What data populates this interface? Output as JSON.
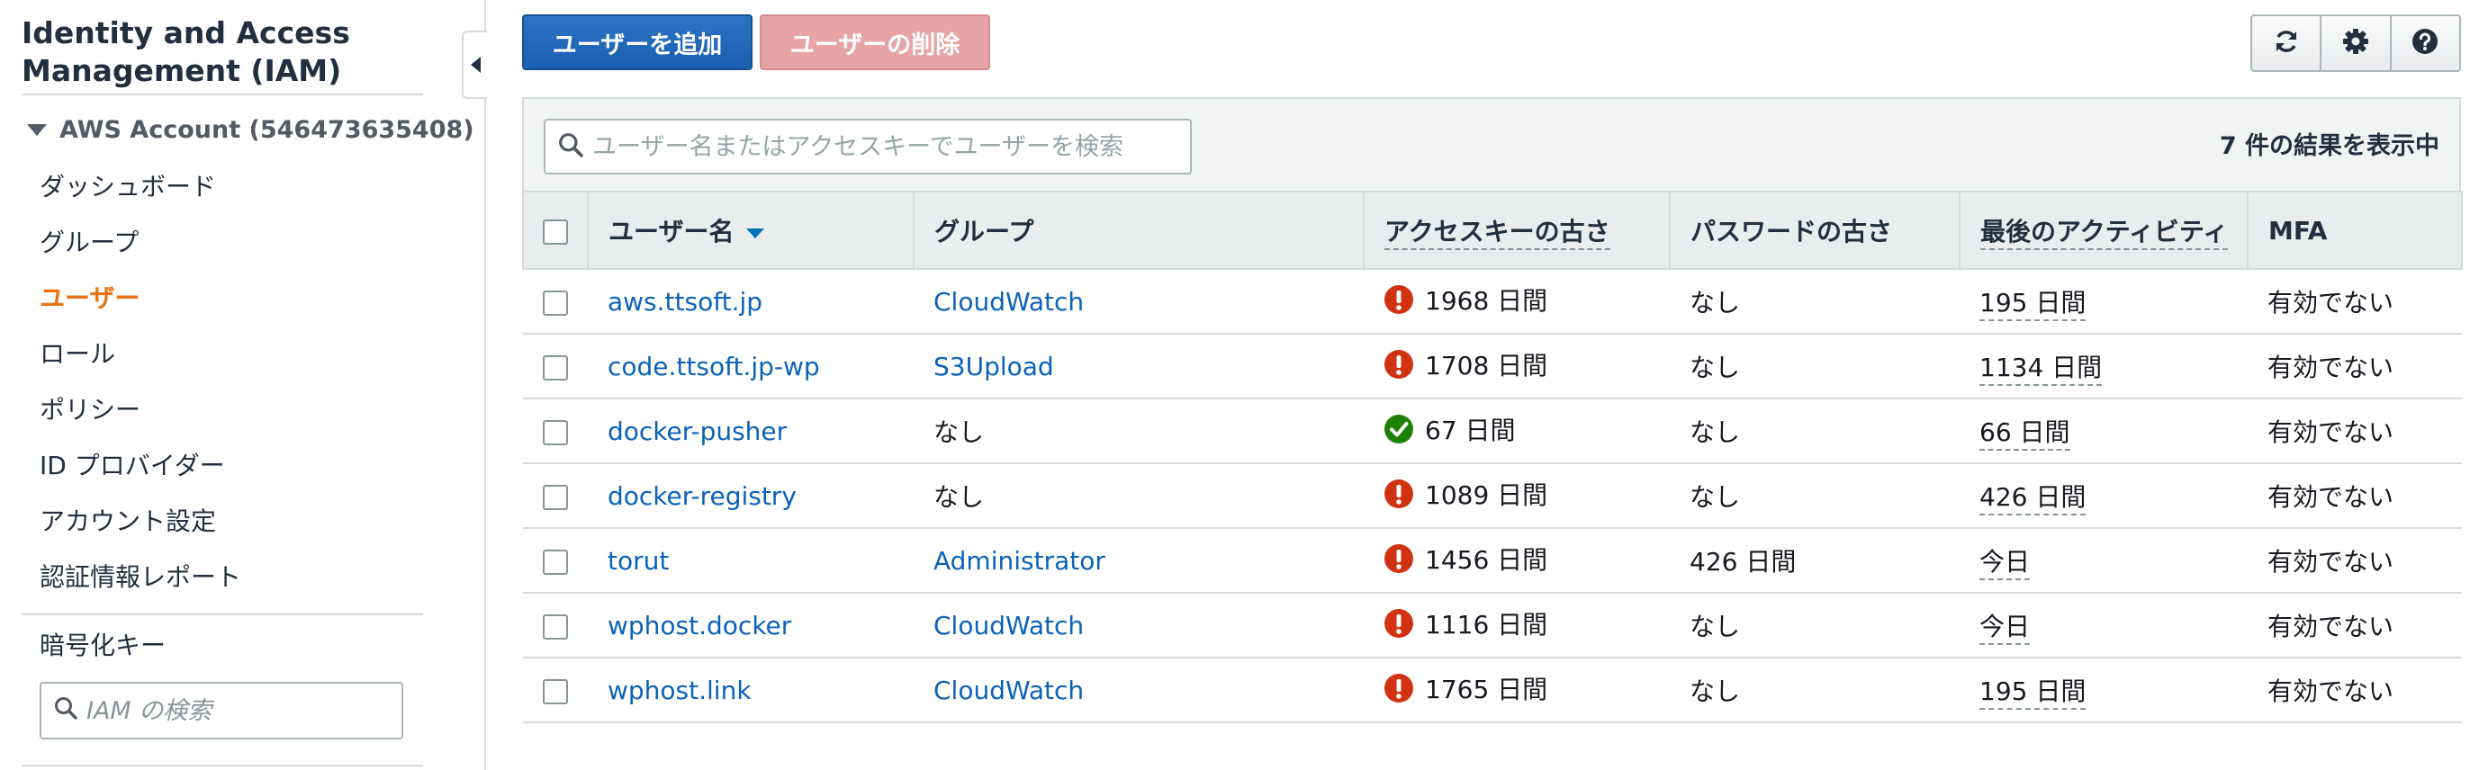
{
  "sidebar": {
    "title_line1": "Identity and Access",
    "title_line2": "Management (IAM)",
    "account": "AWS Account (546473635408)",
    "items": [
      {
        "label": "ダッシュボード",
        "active": false
      },
      {
        "label": "グループ",
        "active": false
      },
      {
        "label": "ユーザー",
        "active": true
      },
      {
        "label": "ロール",
        "active": false
      },
      {
        "label": "ポリシー",
        "active": false
      },
      {
        "label": "ID プロバイダー",
        "active": false
      },
      {
        "label": "アカウント設定",
        "active": false
      },
      {
        "label": "認証情報レポート",
        "active": false
      }
    ],
    "encryption_keys": "暗号化キー",
    "search_placeholder": "IAM の検索"
  },
  "toolbar": {
    "add_user": "ユーザーを追加",
    "delete_user": "ユーザーの削除",
    "icons": [
      "refresh-icon",
      "gear-icon",
      "help-icon"
    ]
  },
  "table": {
    "search_placeholder": "ユーザー名またはアクセスキーでユーザーを検索",
    "result_count": "7 件の結果を表示中",
    "headers": {
      "username": "ユーザー名",
      "group": "グループ",
      "access_key_age": "アクセスキーの古さ",
      "password_age": "パスワードの古さ",
      "last_activity": "最後のアクティビティ",
      "mfa": "MFA"
    },
    "rows": [
      {
        "user": "aws.ttsoft.jp",
        "group": "CloudWatch",
        "group_link": true,
        "key_status": "warning",
        "key_age": "1968 日間",
        "password_age": "なし",
        "last_activity": "195 日間",
        "mfa": "有効でない"
      },
      {
        "user": "code.ttsoft.jp-wp",
        "group": "S3Upload",
        "group_link": true,
        "key_status": "warning",
        "key_age": "1708 日間",
        "password_age": "なし",
        "last_activity": "1134 日間",
        "mfa": "有効でない"
      },
      {
        "user": "docker-pusher",
        "group": "なし",
        "group_link": false,
        "key_status": "ok",
        "key_age": "67 日間",
        "password_age": "なし",
        "last_activity": "66 日間",
        "mfa": "有効でない"
      },
      {
        "user": "docker-registry",
        "group": "なし",
        "group_link": false,
        "key_status": "warning",
        "key_age": "1089 日間",
        "password_age": "なし",
        "last_activity": "426 日間",
        "mfa": "有効でない"
      },
      {
        "user": "torut",
        "group": "Administrator",
        "group_link": true,
        "key_status": "warning",
        "key_age": "1456 日間",
        "password_age": "426 日間",
        "last_activity": "今日",
        "mfa": "有効でない"
      },
      {
        "user": "wphost.docker",
        "group": "CloudWatch",
        "group_link": true,
        "key_status": "warning",
        "key_age": "1116 日間",
        "password_age": "なし",
        "last_activity": "今日",
        "mfa": "有効でない"
      },
      {
        "user": "wphost.link",
        "group": "CloudWatch",
        "group_link": true,
        "key_status": "warning",
        "key_age": "1765 日間",
        "password_age": "なし",
        "last_activity": "195 日間",
        "mfa": "有効でない"
      }
    ]
  },
  "colors": {
    "primary_button": "#1a5fb0",
    "danger_button_disabled": "#e6a4a4",
    "active_nav": "#ec7211",
    "link": "#0b62b8",
    "warning_icon": "#d13212",
    "ok_icon": "#1d8102"
  }
}
